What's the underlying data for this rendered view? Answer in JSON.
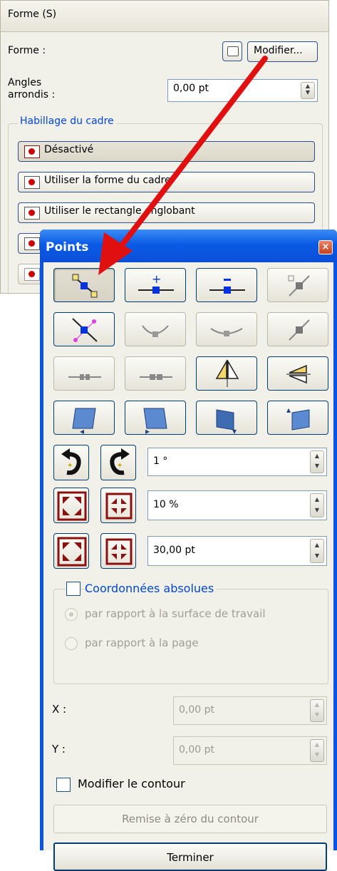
{
  "shape_panel": {
    "title": "Forme (S)",
    "forme_label": "Forme :",
    "modify_label": "Modifier...",
    "angles_label_1": "Angles",
    "angles_label_2": "arrondis :",
    "angles_value": "0,00 pt",
    "wrap_group_label": "Habillage du cadre",
    "wrap_options": [
      "Désactivé",
      "Utiliser la forme du cadre",
      "Utiliser le rectangle englobant"
    ]
  },
  "points_dialog": {
    "title": "Points",
    "close_glyph": "×",
    "rotate_value": "1 °",
    "scale_percent_value": "10 %",
    "scale_pt_value": "30,00 pt",
    "absolute_coords_label": "Coordonnées absolues",
    "radio_workspace_label": "par rapport à la surface de travail",
    "radio_page_label": "par rapport à la page",
    "x_label": "X :",
    "y_label": "Y :",
    "x_value": "0,00 pt",
    "y_value": "0,00 pt",
    "modify_contour_label": "Modifier le contour",
    "reset_contour_label": "Remise à zéro du contour",
    "finish_label": "Terminer"
  },
  "colors": {
    "titlebar": "#0a54e4",
    "panel_bg": "#f1f1ea",
    "arrow": "#e01010",
    "link_blue": "#0046d5"
  }
}
